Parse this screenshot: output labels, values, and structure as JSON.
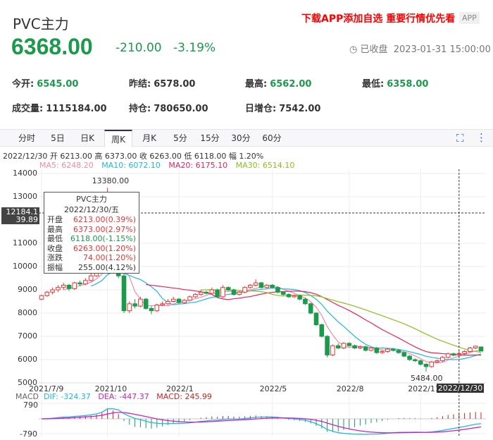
{
  "header": {
    "title": "PVC主力",
    "price": "6368.00",
    "change": "-210.00",
    "change_pct": "-3.19%",
    "promo": "下载APP添加自选 重要行情优先看",
    "app_badge": "APP",
    "status": "已收盘",
    "datetime": "2023-01-31 15:00:00"
  },
  "stats": [
    {
      "label": "今开:",
      "value": "6545.00"
    },
    {
      "label": "昨结:",
      "value": "6578.00"
    },
    {
      "label": "最高:",
      "value": "6562.00"
    },
    {
      "label": "最低:",
      "value": "6358.00"
    },
    {
      "label": "成交量:",
      "value": "1115184.00"
    },
    {
      "label": "持仓:",
      "value": "780650.00"
    },
    {
      "label": "日增仓:",
      "value": "7542.00"
    }
  ],
  "tabs": [
    "分时",
    "5日",
    "日K",
    "周K",
    "月K",
    "5分",
    "15分",
    "30分",
    "60分"
  ],
  "active_tab": "周K",
  "legend": {
    "line": "2022/12/30  开 6213.00  高 6373.00  收 6263.00  低 6118.00  幅 1.20%",
    "ma5": "MA5: 6248.20",
    "ma10": "MA10: 6072.10",
    "ma20": "MA20: 6175.10",
    "ma30": "MA30: 6514.10"
  },
  "colors": {
    "up": "#e33",
    "down": "#1a9a4a",
    "ma5": "#f48aa8",
    "ma10": "#1fb8e0",
    "ma20": "#e8235a",
    "ma30": "#8cbf1f",
    "dif": "#1fb8e0",
    "dea": "#d020c0"
  },
  "tooltip": {
    "title": "PVC主力",
    "date": "2022/12/30/五",
    "rows": [
      {
        "k": "开盘",
        "v": "6213.00(0.39%)",
        "c": "red"
      },
      {
        "k": "最高",
        "v": "6373.00(2.97%)",
        "c": "red"
      },
      {
        "k": "最低",
        "v": "6118.00(-1.15%)",
        "c": "g"
      },
      {
        "k": "收盘",
        "v": "6263.00(1.20%)",
        "c": "red"
      },
      {
        "k": "涨跌",
        "v": "74.00(1.20%)",
        "c": "red"
      },
      {
        "k": "振幅",
        "v": "255.00(4.12%)",
        "c": ""
      }
    ]
  },
  "crosshair": {
    "price": "12184.1",
    "pct": "39.89",
    "date": "2022/12/30"
  },
  "macd": {
    "label": "MACD",
    "dif": "DIF: -324.37",
    "dea": "DEA: -447.37",
    "macd": "MACD: 245.99",
    "ticks": [
      "790",
      "-790"
    ]
  },
  "chart_data": {
    "type": "candlestick",
    "ylim": [
      5000,
      14000
    ],
    "yticks": [
      14000,
      13000,
      11000,
      10000,
      9000,
      8000,
      7000,
      6000,
      5000
    ],
    "max_label": "13380.00",
    "min_label": "5484.00",
    "xlabels": [
      {
        "i": 0,
        "t": "2021/7/9"
      },
      {
        "i": 12,
        "t": "2021/10"
      },
      {
        "i": 25,
        "t": "2022/1"
      },
      {
        "i": 42,
        "t": "2022/5"
      },
      {
        "i": 56,
        "t": "2022/8"
      },
      {
        "i": 69,
        "t": "2022/11"
      }
    ],
    "ohlc": [
      [
        8600,
        8800,
        8550,
        8750
      ],
      [
        8750,
        8950,
        8700,
        8900
      ],
      [
        8900,
        9100,
        8800,
        9000
      ],
      [
        9000,
        9200,
        8900,
        9100
      ],
      [
        9100,
        9300,
        9000,
        9200
      ],
      [
        9200,
        9250,
        8950,
        9050
      ],
      [
        9050,
        9350,
        9000,
        9300
      ],
      [
        9300,
        9400,
        9150,
        9250
      ],
      [
        9250,
        9500,
        9200,
        9400
      ],
      [
        9400,
        9700,
        9350,
        9600
      ],
      [
        9600,
        9900,
        9550,
        9800
      ],
      [
        9800,
        10400,
        9750,
        10300
      ],
      [
        10300,
        13380,
        10200,
        11500
      ],
      [
        11500,
        11800,
        10000,
        10200
      ],
      [
        10200,
        10400,
        9500,
        9600
      ],
      [
        9600,
        9700,
        8000,
        8100
      ],
      [
        8100,
        8500,
        8000,
        8400
      ],
      [
        8400,
        8600,
        8200,
        8300
      ],
      [
        8300,
        8700,
        8250,
        8600
      ],
      [
        8600,
        8650,
        8150,
        8200
      ],
      [
        8200,
        8300,
        7950,
        8100
      ],
      [
        8100,
        8400,
        8050,
        8350
      ],
      [
        8350,
        8500,
        8300,
        8400
      ],
      [
        8400,
        8600,
        8350,
        8500
      ],
      [
        8500,
        8700,
        8450,
        8600
      ],
      [
        8600,
        8650,
        8400,
        8450
      ],
      [
        8450,
        8600,
        8400,
        8550
      ],
      [
        8550,
        8750,
        8500,
        8700
      ],
      [
        8700,
        8850,
        8650,
        8800
      ],
      [
        8800,
        9000,
        8750,
        8900
      ],
      [
        8900,
        8950,
        8800,
        8850
      ],
      [
        8850,
        9100,
        8800,
        9000
      ],
      [
        9000,
        9050,
        8650,
        8700
      ],
      [
        8700,
        9200,
        8650,
        9100
      ],
      [
        9100,
        9150,
        8950,
        9000
      ],
      [
        9000,
        9050,
        8750,
        8800
      ],
      [
        8800,
        8950,
        8750,
        8900
      ],
      [
        8900,
        9150,
        8850,
        9100
      ],
      [
        9100,
        9250,
        9050,
        9200
      ],
      [
        9200,
        9450,
        9150,
        9300
      ],
      [
        9300,
        9350,
        9050,
        9100
      ],
      [
        9100,
        9250,
        9050,
        9200
      ],
      [
        9200,
        9250,
        9050,
        9100
      ],
      [
        9100,
        9150,
        8850,
        8900
      ],
      [
        8900,
        8950,
        8750,
        8800
      ],
      [
        8800,
        8850,
        8650,
        8700
      ],
      [
        8700,
        8800,
        8650,
        8750
      ],
      [
        8750,
        8800,
        8550,
        8600
      ],
      [
        8600,
        8650,
        8350,
        8400
      ],
      [
        8400,
        8450,
        7950,
        8000
      ],
      [
        8000,
        8050,
        7450,
        7500
      ],
      [
        7500,
        7550,
        6950,
        7000
      ],
      [
        7000,
        7050,
        6100,
        6200
      ],
      [
        6200,
        6650,
        6150,
        6600
      ],
      [
        6600,
        6700,
        6450,
        6500
      ],
      [
        6500,
        6750,
        6450,
        6700
      ],
      [
        6700,
        6750,
        6550,
        6600
      ],
      [
        6600,
        6650,
        6450,
        6500
      ],
      [
        6500,
        6600,
        6450,
        6550
      ],
      [
        6550,
        6600,
        6350,
        6400
      ],
      [
        6400,
        6550,
        6350,
        6500
      ],
      [
        6500,
        6550,
        6250,
        6300
      ],
      [
        6300,
        6400,
        6250,
        6350
      ],
      [
        6350,
        6500,
        6300,
        6450
      ],
      [
        6450,
        6500,
        6350,
        6400
      ],
      [
        6400,
        6450,
        6250,
        6300
      ],
      [
        6300,
        6350,
        6100,
        6150
      ],
      [
        6150,
        6200,
        5950,
        6000
      ],
      [
        6000,
        6050,
        5900,
        5950
      ],
      [
        5950,
        6000,
        5750,
        5800
      ],
      [
        5800,
        5850,
        5484,
        5700
      ],
      [
        5700,
        5950,
        5650,
        5900
      ],
      [
        5900,
        6000,
        5850,
        5950
      ],
      [
        5950,
        6150,
        5900,
        6100
      ],
      [
        6100,
        6300,
        6050,
        6250
      ],
      [
        6250,
        6300,
        6150,
        6189
      ],
      [
        6213,
        6373,
        6118,
        6263
      ],
      [
        6263,
        6400,
        6200,
        6350
      ],
      [
        6350,
        6550,
        6300,
        6500
      ],
      [
        6500,
        6600,
        6450,
        6578
      ],
      [
        6545,
        6562,
        6358,
        6368
      ]
    ],
    "crosshair_index": 76
  }
}
